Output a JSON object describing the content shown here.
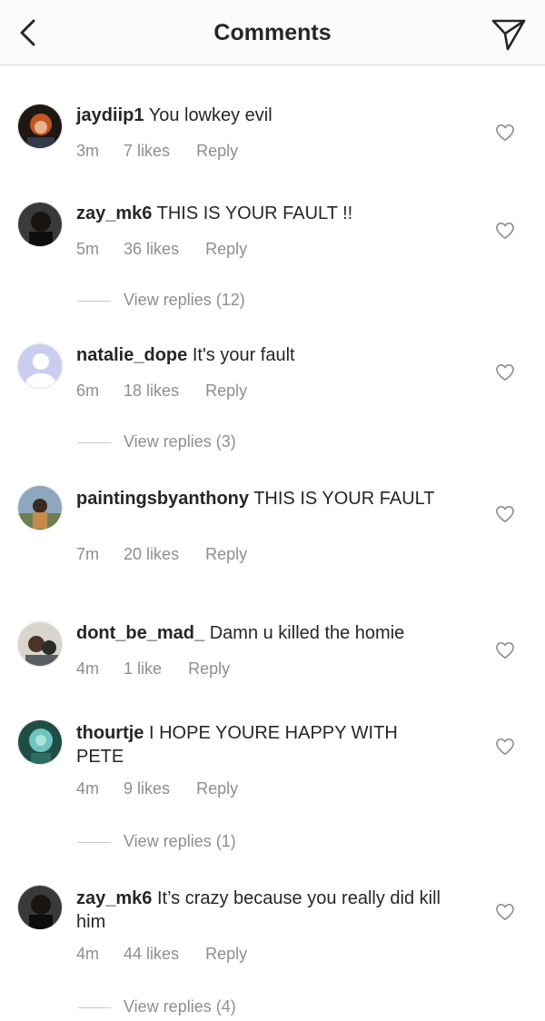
{
  "header": {
    "title": "Comments",
    "back_icon": "chevron-left-icon",
    "send_icon": "paper-plane-icon"
  },
  "comments": [
    {
      "username": "jaydiip1",
      "text": "You lowkey evil",
      "time": "3m",
      "likes": "7 likes",
      "reply": "Reply",
      "view_replies": null
    },
    {
      "username": "zay_mk6",
      "text": "THIS IS YOUR FAULT !!",
      "time": "5m",
      "likes": "36 likes",
      "reply": "Reply",
      "view_replies": "View replies (12)"
    },
    {
      "username": "natalie_dope",
      "text": "It's your fault",
      "time": "6m",
      "likes": "18 likes",
      "reply": "Reply",
      "view_replies": "View replies (3)"
    },
    {
      "username": "paintingsbyanthony",
      "text": "THIS IS YOUR FAULT",
      "time": "7m",
      "likes": "20 likes",
      "reply": "Reply",
      "view_replies": null
    },
    {
      "username": "dont_be_mad_",
      "text": "Damn u killed the homie",
      "time": "4m",
      "likes": "1 like",
      "reply": "Reply",
      "view_replies": null
    },
    {
      "username": "thourtje",
      "text": "I HOPE YOURE HAPPY WITH PETE",
      "time": "4m",
      "likes": "9 likes",
      "reply": "Reply",
      "view_replies": "View replies (1)"
    },
    {
      "username": "zay_mk6",
      "text": "It’s crazy because you really did kill him",
      "time": "4m",
      "likes": "44 likes",
      "reply": "Reply",
      "view_replies": "View replies (4)"
    }
  ],
  "colors": {
    "text": "#262626",
    "meta": "#8e8e8e",
    "header_bg": "#fbfbfb",
    "divider": "#d8d8d8"
  }
}
